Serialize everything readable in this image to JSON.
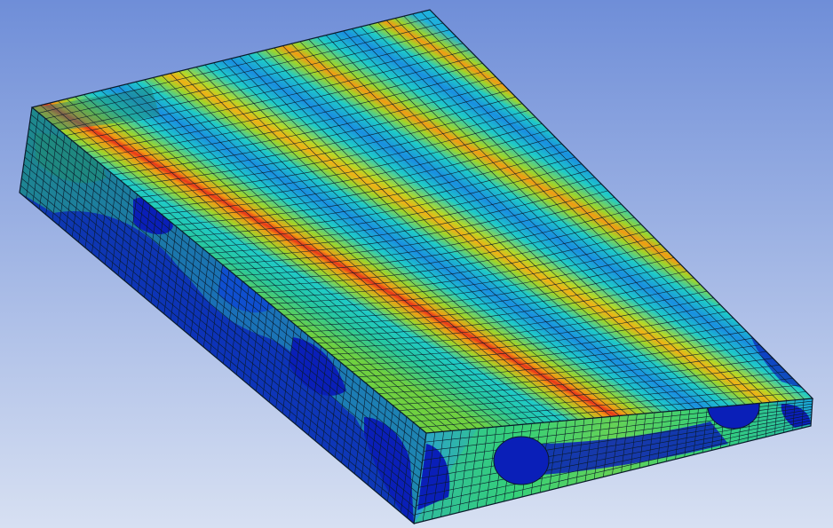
{
  "viewport": {
    "background_top": "#6f8ed8",
    "background_bottom": "#d7e0f2",
    "mesh_line_color": "#0a1a2a",
    "contour_colors": [
      "#0a1fb8",
      "#0f63d6",
      "#1aa0e0",
      "#1fcac8",
      "#27d188",
      "#9fd42a",
      "#e6d81e",
      "#f29a14",
      "#e8361a"
    ]
  }
}
